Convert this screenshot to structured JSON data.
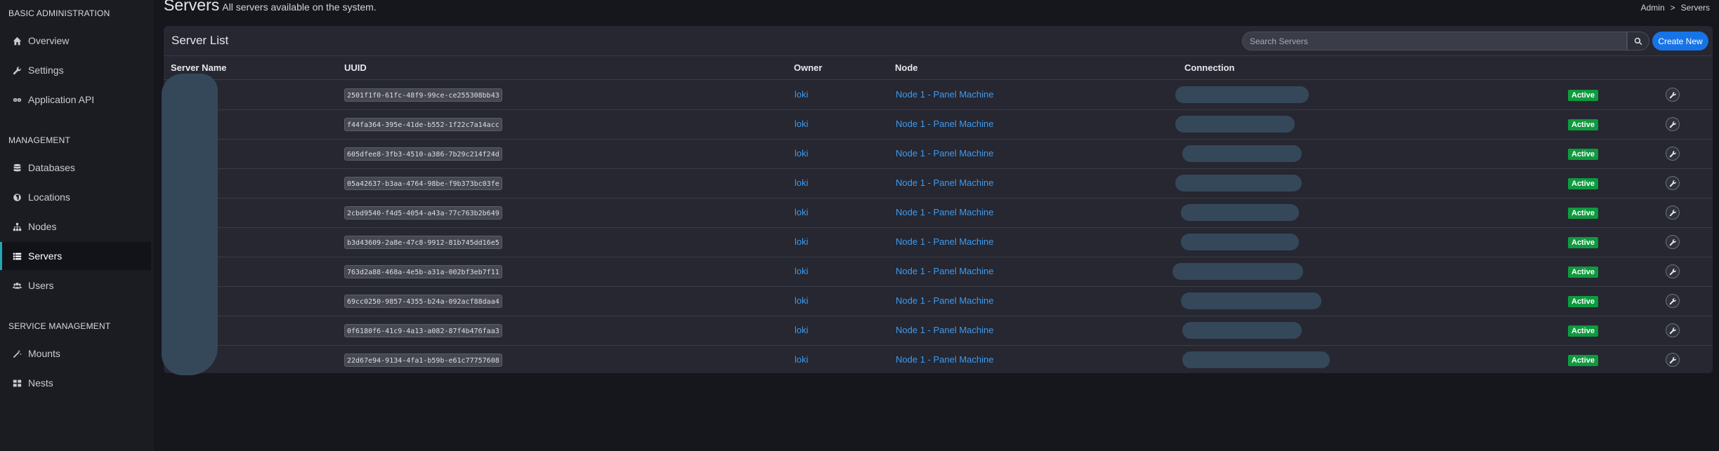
{
  "sidebar": {
    "sections": [
      {
        "header": "BASIC ADMINISTRATION",
        "items": [
          {
            "label": "Overview",
            "icon": "home-icon"
          },
          {
            "label": "Settings",
            "icon": "wrench-icon"
          },
          {
            "label": "Application API",
            "icon": "link-icon"
          }
        ]
      },
      {
        "header": "MANAGEMENT",
        "items": [
          {
            "label": "Databases",
            "icon": "database-icon"
          },
          {
            "label": "Locations",
            "icon": "globe-icon"
          },
          {
            "label": "Nodes",
            "icon": "sitemap-icon"
          },
          {
            "label": "Servers",
            "icon": "server-list-icon",
            "active": true
          },
          {
            "label": "Users",
            "icon": "users-icon"
          }
        ]
      },
      {
        "header": "SERVICE MANAGEMENT",
        "items": [
          {
            "label": "Mounts",
            "icon": "magic-icon"
          },
          {
            "label": "Nests",
            "icon": "grid-icon"
          }
        ]
      }
    ]
  },
  "header": {
    "title": "Servers",
    "subtitle": "All servers available on the system.",
    "breadcrumb": [
      "Admin",
      ">",
      "Servers"
    ]
  },
  "box": {
    "title": "Server List",
    "search_placeholder": "Search Servers",
    "create_label": "Create New"
  },
  "table": {
    "columns": [
      "Server Name",
      "UUID",
      "Owner",
      "Node",
      "Connection"
    ],
    "rows": [
      {
        "uuid": "2501f1f0-61fc-48f9-99ce-ce255308bb43",
        "owner": "loki",
        "node": "Node 1 - Panel Machine",
        "status": "Active"
      },
      {
        "uuid": "f44fa364-395e-41de-b552-1f22c7a14acc",
        "owner": "loki",
        "node": "Node 1 - Panel Machine",
        "status": "Active"
      },
      {
        "uuid": "605dfee8-3fb3-4510-a386-7b29c214f24d",
        "owner": "loki",
        "node": "Node 1 - Panel Machine",
        "status": "Active"
      },
      {
        "uuid": "05a42637-b3aa-4764-98be-f9b373bc03fe",
        "owner": "loki",
        "node": "Node 1 - Panel Machine",
        "status": "Active"
      },
      {
        "uuid": "2cbd9540-f4d5-4054-a43a-77c763b2b649",
        "owner": "loki",
        "node": "Node 1 - Panel Machine",
        "status": "Active"
      },
      {
        "uuid": "b3d43609-2a8e-47c8-9912-81b745dd16e5",
        "owner": "loki",
        "node": "Node 1 - Panel Machine",
        "status": "Active"
      },
      {
        "uuid": "763d2a88-468a-4e5b-a31a-002bf3eb7f11",
        "owner": "loki",
        "node": "Node 1 - Panel Machine",
        "status": "Active"
      },
      {
        "uuid": "69cc0250-9857-4355-b24a-092acf88daa4",
        "owner": "loki",
        "node": "Node 1 - Panel Machine",
        "status": "Active"
      },
      {
        "uuid": "0f6180f6-41c9-4a13-a082-87f4b476faa3",
        "owner": "loki",
        "node": "Node 1 - Panel Machine",
        "status": "Active"
      },
      {
        "uuid": "22d67e94-9134-4fa1-b59b-e61c77757608",
        "owner": "loki",
        "node": "Node 1 - Panel Machine",
        "status": "Active"
      }
    ]
  },
  "colors": {
    "accent": "#1774e6",
    "link": "#3d9bf0",
    "active_badge": "#0e9a3e",
    "sidebar_active_border": "#23a6b8"
  }
}
